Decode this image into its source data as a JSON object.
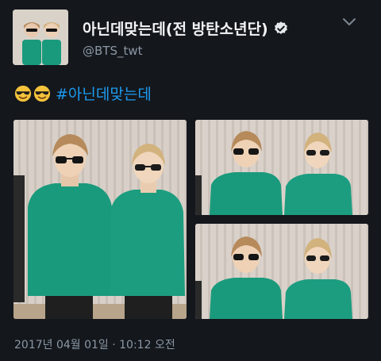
{
  "user": {
    "display_name": "아닌데맞는데(전 방탄소년단)",
    "handle": "@BTS_twt",
    "verified": true
  },
  "tweet": {
    "emojis": [
      "smiling-face-with-sunglasses",
      "smiling-face-with-sunglasses"
    ],
    "hashtag": "#아닌데맞는데",
    "timestamp": "2017년 04월 01일 · 10:12 오전"
  },
  "colors": {
    "background": "#14171c",
    "hashtag": "#1d9bf0",
    "muted_text": "#8b98a5",
    "sweater": "#1a9a7c"
  }
}
